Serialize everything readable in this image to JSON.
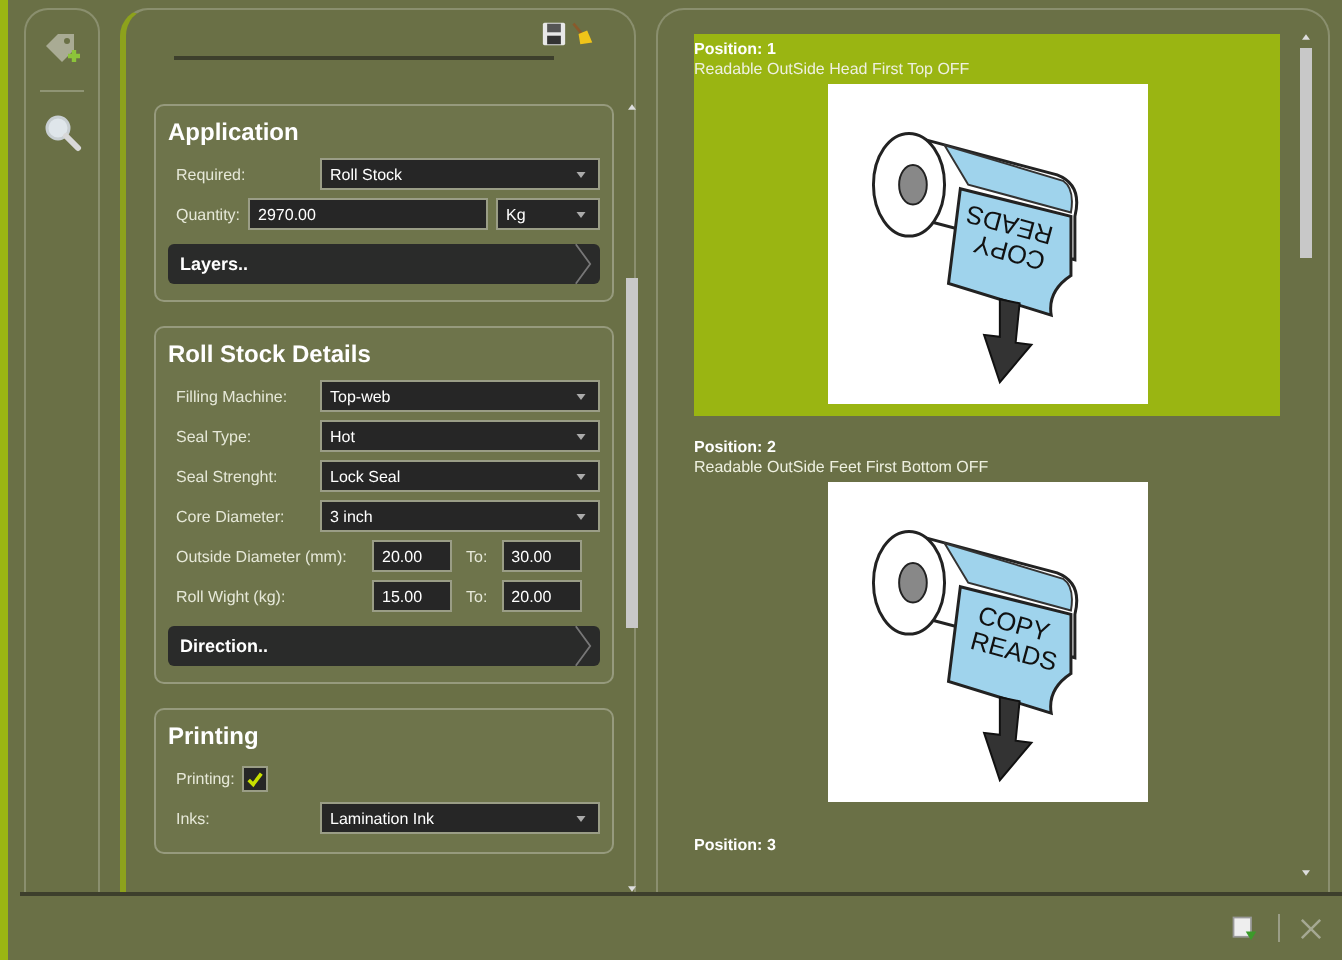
{
  "form": {
    "sections": [
      {
        "title": "Application",
        "fields": [
          {
            "kind": "select",
            "label": "Required:",
            "value": "Roll Stock"
          },
          {
            "kind": "quantity",
            "label": "Quantity:",
            "value": "2970.00",
            "unit": "Kg"
          }
        ],
        "expander": "Layers.."
      },
      {
        "title": "Roll Stock Details",
        "fields": [
          {
            "kind": "select",
            "label": "Filling Machine:",
            "value": "Top-web"
          },
          {
            "kind": "select",
            "label": "Seal Type:",
            "value": "Hot"
          },
          {
            "kind": "select",
            "label": "Seal Strenght:",
            "value": "Lock Seal"
          },
          {
            "kind": "select",
            "label": "Core Diameter:",
            "value": "3 inch"
          },
          {
            "kind": "range",
            "label": "Outside Diameter (mm):",
            "value": "20.00",
            "to_label": "To:",
            "to_value": "30.00"
          },
          {
            "kind": "range",
            "label": "Roll Wight (kg):",
            "value": "15.00",
            "to_label": "To:",
            "to_value": "20.00"
          }
        ],
        "expander": "Direction.."
      },
      {
        "title": "Printing",
        "fields": [
          {
            "kind": "checkbox",
            "label": "Printing:",
            "checked": true
          },
          {
            "kind": "select",
            "label": "Inks:",
            "value": "Lamination Ink"
          }
        ]
      }
    ]
  },
  "positions": [
    {
      "title": "Position: 1",
      "description": "Readable OutSide Head First Top OFF",
      "selected": true,
      "kind": "inverted",
      "label_lines": [
        "COPY",
        "READS"
      ]
    },
    {
      "title": "Position: 2",
      "description": "Readable OutSide Feet First Bottom OFF",
      "selected": false,
      "kind": "upright",
      "label_lines": [
        "COPY",
        "READS"
      ]
    },
    {
      "title": "Position: 3",
      "selected": false
    }
  ]
}
